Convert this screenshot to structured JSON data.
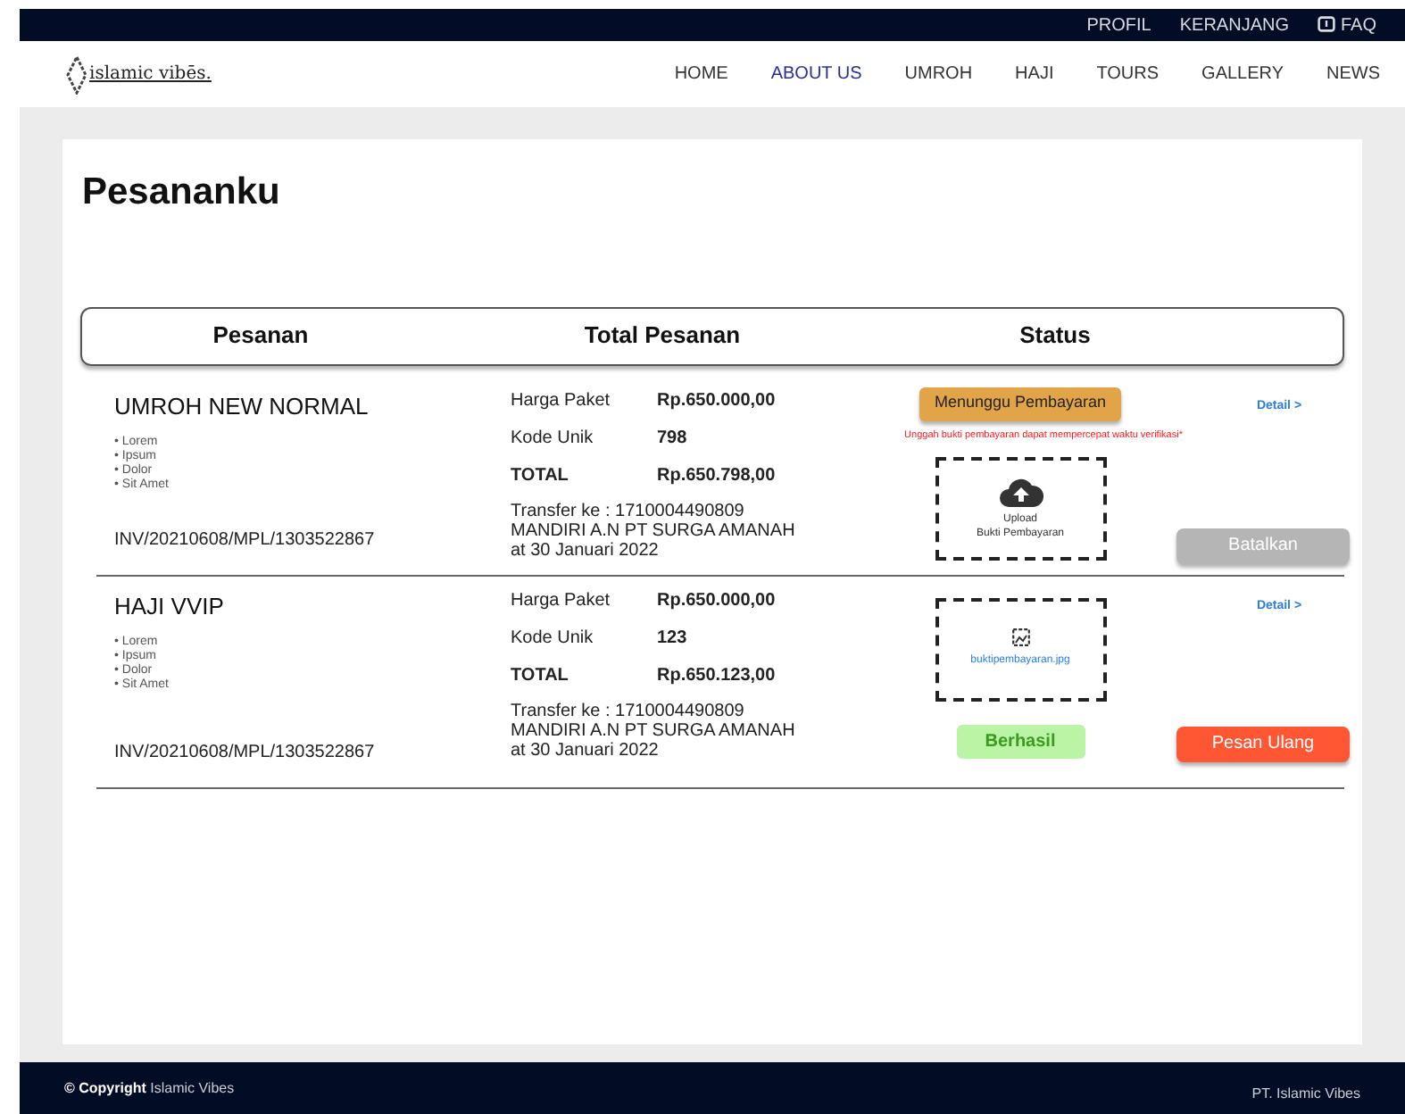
{
  "top_bar": {
    "links": [
      {
        "label": "PROFIL",
        "kind": "text"
      },
      {
        "label": "KERANJANG",
        "kind": "text"
      },
      {
        "label": "FAQ",
        "kind": "faq"
      }
    ]
  },
  "nav": {
    "logo": "islamic vibēs.",
    "items": [
      {
        "label": "HOME",
        "selected": false
      },
      {
        "label": "ABOUT US",
        "selected": true
      },
      {
        "label": "UMROH",
        "selected": false
      },
      {
        "label": "HAJI",
        "selected": false
      },
      {
        "label": "TOURS",
        "selected": false
      },
      {
        "label": "GALLERY",
        "selected": false
      },
      {
        "label": "NEWS",
        "selected": false
      }
    ]
  },
  "page_title": "Pesananku",
  "table": {
    "columns": [
      "Pesanan",
      "Total Pesanan",
      "Status"
    ],
    "rows": [
      {
        "name": "UMROH NEW NORMAL",
        "features": [
          "• Lorem",
          "• Ipsum",
          "• Dolor",
          "• Sit Amet"
        ],
        "invoice": "INV/20210608/MPL/1303522867",
        "price_label": "Harga Paket",
        "price": "Rp.650.000,00",
        "code_label": "Kode Unik",
        "code": "798",
        "total_label": "TOTAL",
        "total": "Rp.650.798,00",
        "transfer": [
          "Transfer ke : 1710004490809",
          "MANDIRI A.N PT SURGA AMANAH",
          "at 30 Januari 2022"
        ],
        "status": {
          "kind": "pending",
          "label": "Menunggu Pembayaran"
        },
        "note": "Unggah bukti pembayaran dapat mempercepat waktu verifikasi*",
        "proof": {
          "kind": "upload",
          "label": [
            "Upload",
            "Bukti Pembayaran"
          ]
        },
        "detail": "Detail >",
        "action": {
          "label": "Batalkan",
          "disabled": true
        }
      },
      {
        "name": "HAJI VVIP",
        "features": [
          "• Lorem",
          "• Ipsum",
          "• Dolor",
          "• Sit Amet"
        ],
        "invoice": "INV/20210608/MPL/1303522867",
        "price_label": "Harga Paket",
        "price": "Rp.650.000,00",
        "code_label": "Kode Unik",
        "code": "123",
        "total_label": "TOTAL",
        "total": "Rp.650.123,00",
        "transfer": [
          "Transfer ke : 1710004490809",
          "MANDIRI A.N PT SURGA AMANAH",
          "at 30 Januari 2022"
        ],
        "status": {
          "kind": "done",
          "label": "Berhasil"
        },
        "proof": {
          "kind": "file",
          "label": [
            "buktipembayaran.jpg"
          ]
        },
        "detail": "Detail >",
        "action": {
          "label": "Pesan Ulang",
          "disabled": false
        }
      }
    ]
  },
  "footer": {
    "copyright_bold": "© Copyright",
    "copyright": "Islamic Vibes",
    "company": "PT. Islamic Vibes"
  }
}
